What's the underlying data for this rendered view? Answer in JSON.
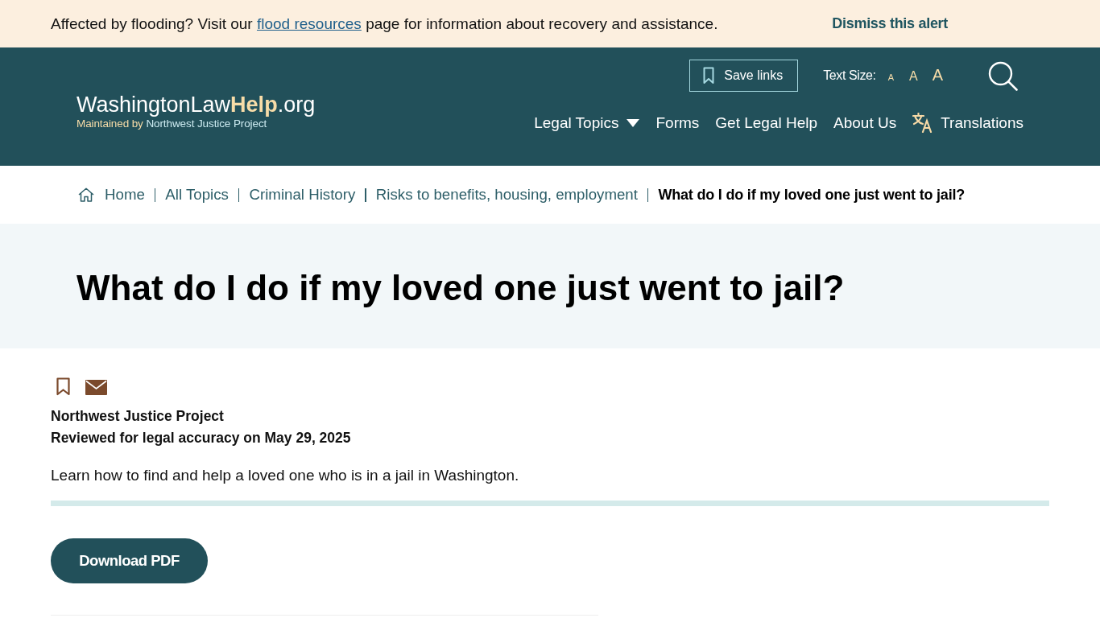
{
  "alert": {
    "text_before": "Affected by flooding? Visit our",
    "link": "flood resources",
    "text_after": "page for information about recovery and assistance.",
    "dismiss": "Dismiss this alert"
  },
  "header": {
    "logo": {
      "name": "WashingtonLaw",
      "highlight": "Help",
      "suffix": ".org",
      "tagline_prefix": "Maintained by",
      "tagline_org": "Northwest Justice Project"
    },
    "save_links": "Save links",
    "text_size": {
      "label": "Text Size:",
      "options": [
        {
          "label": "A",
          "kind": "small"
        },
        {
          "label": "A",
          "kind": "medium"
        },
        {
          "label": "A",
          "kind": "large"
        }
      ]
    },
    "nav": [
      {
        "label": "Legal Topics",
        "kind": "dropdown"
      },
      {
        "label": "Forms",
        "kind": "link"
      },
      {
        "label": "Get Legal Help",
        "kind": "link"
      },
      {
        "label": "About Us",
        "kind": "link"
      },
      {
        "label": "Translations",
        "kind": "translate"
      }
    ]
  },
  "breadcrumb": [
    {
      "label": "Home",
      "kind": "home",
      "current": false
    },
    {
      "label": "All Topics",
      "kind": "link",
      "current": false
    },
    {
      "label": "Criminal History",
      "kind": "link",
      "current": false
    },
    {
      "label": "Risks to benefits, housing, employment",
      "kind": "link",
      "current": false
    },
    {
      "label": "What do I do if my loved one just went to jail?",
      "kind": "link",
      "current": true
    }
  ],
  "page_title": "What do I do if my loved one just went to jail?",
  "article": {
    "author": "Northwest Justice Project",
    "reviewed": "Reviewed for legal accuracy on May 29, 2025",
    "summary": "Learn how to find and help a loved one who is in a jail in Washington.",
    "download_button": "Download PDF"
  }
}
